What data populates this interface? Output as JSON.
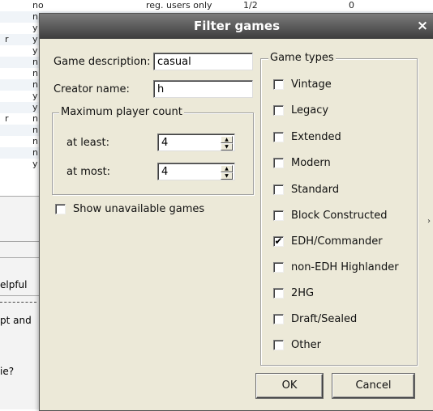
{
  "background": {
    "rows": [
      {
        "a": "",
        "b": "no",
        "c": "reg. users only",
        "d": "1/2",
        "e": "0"
      },
      {
        "a": "",
        "b": "n",
        "c": "",
        "d": "",
        "e": ""
      },
      {
        "a": "",
        "b": "y",
        "c": "",
        "d": "",
        "e": ""
      },
      {
        "a": "r",
        "b": "y",
        "c": "",
        "d": "",
        "e": ""
      },
      {
        "a": "",
        "b": "y",
        "c": "",
        "d": "",
        "e": ""
      },
      {
        "a": "",
        "b": "n",
        "c": "",
        "d": "",
        "e": ""
      },
      {
        "a": "",
        "b": "n",
        "c": "",
        "d": "",
        "e": ""
      },
      {
        "a": "",
        "b": "n",
        "c": "",
        "d": "",
        "e": ""
      },
      {
        "a": "",
        "b": "y",
        "c": "",
        "d": "",
        "e": ""
      },
      {
        "a": "",
        "b": "y",
        "c": "",
        "d": "",
        "e": ""
      },
      {
        "a": "r",
        "b": "n",
        "c": "",
        "d": "",
        "e": ""
      },
      {
        "a": "",
        "b": "n",
        "c": "",
        "d": "",
        "e": ""
      },
      {
        "a": "",
        "b": "n",
        "c": "",
        "d": "",
        "e": ""
      },
      {
        "a": "",
        "b": "n",
        "c": "",
        "d": "",
        "e": ""
      },
      {
        "a": "",
        "b": "y",
        "c": "",
        "d": "",
        "e": ""
      }
    ],
    "text_helpful": "elpful",
    "text_pt": "pt and",
    "text_question": "ie?"
  },
  "dialog": {
    "title": "Filter games",
    "close_glyph": "×",
    "game_description_label": "Game description:",
    "game_description_value": "casual",
    "creator_name_label": "Creator name:",
    "creator_name_value": "h",
    "max_players_group": "Maximum player count",
    "at_least_label": "at least:",
    "at_least_value": "4",
    "at_most_label": "at most:",
    "at_most_value": "4",
    "show_unavailable_label": "Show unavailable games",
    "show_unavailable_checked": false,
    "game_types_group": "Game types",
    "game_types": [
      {
        "label": "Vintage",
        "checked": false
      },
      {
        "label": "Legacy",
        "checked": false
      },
      {
        "label": "Extended",
        "checked": false
      },
      {
        "label": "Modern",
        "checked": false
      },
      {
        "label": "Standard",
        "checked": false
      },
      {
        "label": "Block Constructed",
        "checked": false
      },
      {
        "label": "EDH/Commander",
        "checked": true
      },
      {
        "label": "non-EDH Highlander",
        "checked": false
      },
      {
        "label": "2HG",
        "checked": false
      },
      {
        "label": "Draft/Sealed",
        "checked": false
      },
      {
        "label": "Other",
        "checked": false
      }
    ],
    "check_glyph": "✔",
    "ok_label": "OK",
    "cancel_label": "Cancel"
  }
}
